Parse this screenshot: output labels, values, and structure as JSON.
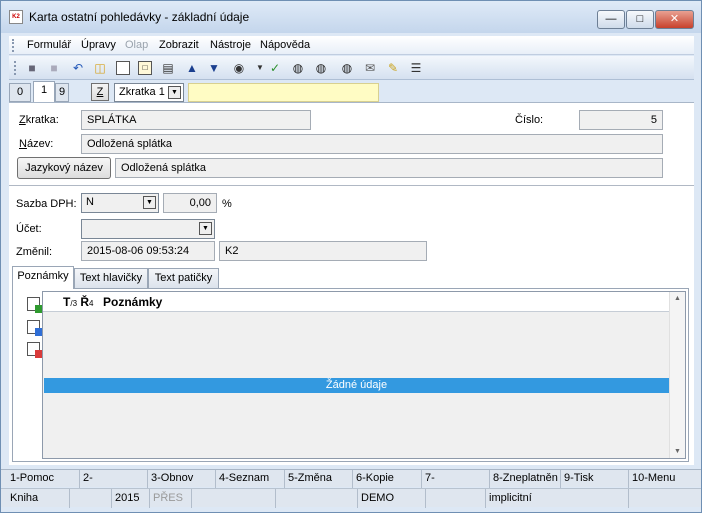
{
  "window": {
    "title": "Karta ostatní pohledávky - základní údaje",
    "app_icon_text": "K2",
    "min_icon": "minimize-icon",
    "max_icon": "maximize-icon",
    "close_icon": "close-icon"
  },
  "menu": [
    "Formulář",
    "Úpravy",
    "Olap",
    "Zobrazit",
    "Nástroje",
    "Nápověda"
  ],
  "toolbar_icons": [
    "save-icon",
    "save-disabled-icon",
    "undo-icon",
    "open-folder-icon",
    "new-document-icon",
    "copy-icon",
    "book-icon",
    "arrow-up-icon",
    "arrow-down-icon",
    "camera-icon",
    "dropdown-icon",
    "filter-icon",
    "binoculars-icon",
    "binoculars-back-icon",
    "binoculars-forward-icon",
    "mail-icon",
    "notepad-icon",
    "list-icon"
  ],
  "selector": {
    "tabs": [
      "0",
      "1",
      "9"
    ],
    "z_button": "Z",
    "abbrev_select": "Zkratka 1"
  },
  "form": {
    "zkratka_label": "Zkratka:",
    "zkratka_value": "SPLÁTKA",
    "cislo_label": "Číslo:",
    "cislo_value": "5",
    "nazev_label": "Název:",
    "nazev_value": "Odložená splátka",
    "jazykovy_button": "Jazykový název",
    "jazykovy_value": "Odložená splátka",
    "sazba_label": "Sazba DPH:",
    "sazba_value": "N",
    "sazba_percent": "0,00",
    "percent_sign": "%",
    "ucet_label": "Účet:",
    "ucet_value": "",
    "zmenil_label": "Změnil:",
    "zmenil_date": "2015-08-06 09:53:24",
    "zmenil_user": "K2"
  },
  "detail_tabs": [
    "Poznámky",
    "Text hlavičky",
    "Text patičky"
  ],
  "grid": {
    "header": "Poznámky",
    "no_data": "Žádné údaje"
  },
  "fkeys": [
    "1-Pomoc",
    "2-",
    "3-Obnov",
    "4-Seznam",
    "5-Změna",
    "6-Kopie",
    "7-",
    "8-Zneplatněn",
    "9-Tisk",
    "10-Menu"
  ],
  "status": {
    "book": "Kniha",
    "year": "2015",
    "pres": "PŘES",
    "db": "DEMO",
    "mode": "implicitní"
  }
}
